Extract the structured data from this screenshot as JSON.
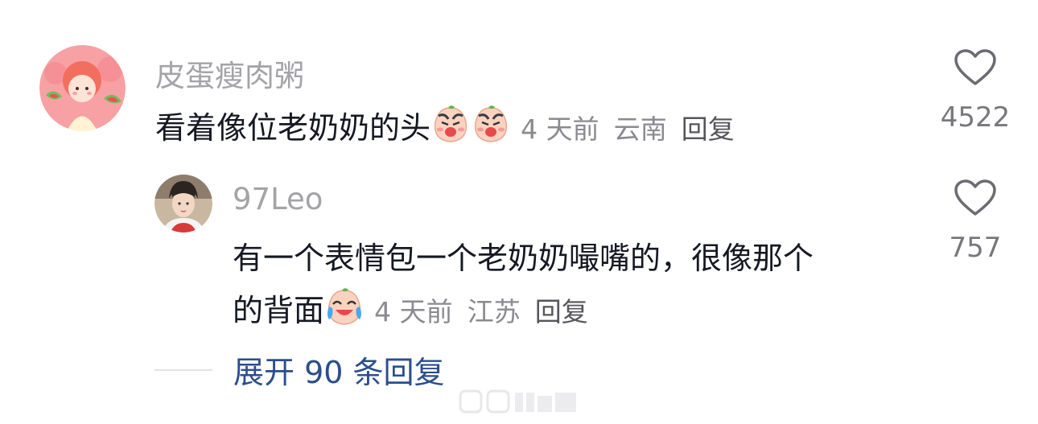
{
  "comment": {
    "username": "皮蛋瘦肉粥",
    "text": "看着像位老奶奶的头",
    "time": "4 天前",
    "location": "云南",
    "reply_label": "回复",
    "likes": "4522"
  },
  "reply": {
    "username": "97Leo",
    "text_line1": "有一个表情包一个老奶奶嘬嘴的，很像那个",
    "text_line2": "的背面",
    "time": "4 天前",
    "location": "江苏",
    "reply_label": "回复",
    "likes": "757"
  },
  "expand": {
    "label": "展开 90 条回复"
  }
}
